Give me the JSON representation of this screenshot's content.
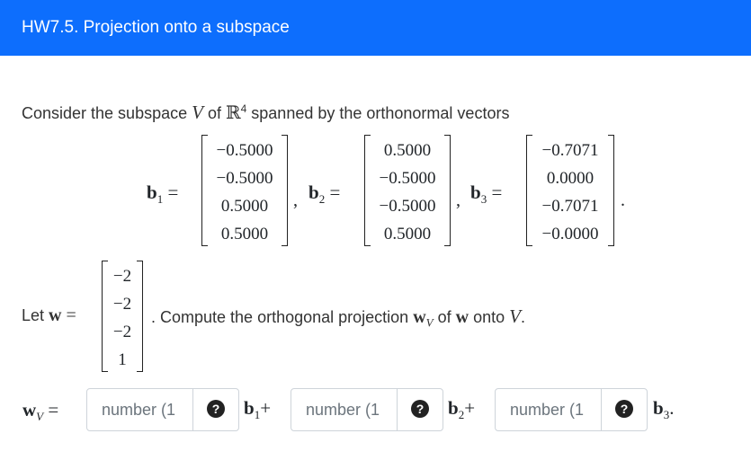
{
  "header": {
    "title": "HW7.5. Projection onto a subspace"
  },
  "intro": {
    "part1": "Consider the subspace ",
    "V": "V",
    "part2": " of ",
    "R": "ℝ",
    "R_exp": "4",
    "part3": " spanned by the orthonormal vectors"
  },
  "vectors": [
    {
      "label": "b",
      "sub": "1",
      "values": [
        "−0.5000",
        "−0.5000",
        "0.5000",
        "0.5000"
      ]
    },
    {
      "label": "b",
      "sub": "2",
      "values": [
        "0.5000",
        "−0.5000",
        "−0.5000",
        "0.5000"
      ]
    },
    {
      "label": "b",
      "sub": "3",
      "values": [
        "−0.7071",
        "0.0000",
        "−0.7071",
        "−0.0000"
      ]
    }
  ],
  "let": {
    "prefix": "Let ",
    "w": "w",
    "equals": "=",
    "values": [
      "−2",
      "−2",
      "−2",
      "1"
    ],
    "suffix1": ". Compute the orthogonal projection ",
    "wv": "w",
    "wv_sub": "V",
    "suffix2": " of ",
    "w2": "w",
    "suffix3": " onto ",
    "V": "V",
    "suffix4": "."
  },
  "answer": {
    "lhs": "w",
    "lhs_sub": "V",
    "equals": "=",
    "inputs": [
      {
        "placeholder": "number (1",
        "value": ""
      },
      {
        "placeholder": "number (1",
        "value": ""
      },
      {
        "placeholder": "number (1",
        "value": ""
      }
    ],
    "help_glyph": "?",
    "basis_labels": [
      "b",
      "b",
      "b"
    ],
    "basis_subs": [
      "1",
      "2",
      "3"
    ],
    "joiners": [
      "+",
      "+",
      "."
    ]
  }
}
